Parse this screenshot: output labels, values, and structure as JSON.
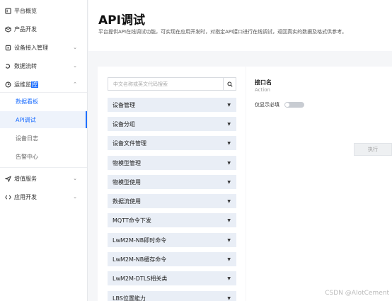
{
  "sidebar": {
    "items": [
      {
        "label": "平台概览",
        "icon": "home-icon",
        "chevron": ""
      },
      {
        "label": "产品开发",
        "icon": "box-icon",
        "chevron": ""
      },
      {
        "label": "设备接入管理",
        "icon": "device-icon",
        "chevron": "⌄"
      },
      {
        "label": "数据流转",
        "icon": "flow-icon",
        "chevron": "⌄"
      },
      {
        "label_pre": "运维监",
        "label_hl": "控",
        "icon": "monitor-icon",
        "chevron": "⌃"
      }
    ],
    "subitems": [
      {
        "label": "数据看板"
      },
      {
        "label": "API调试"
      },
      {
        "label": "设备日志"
      },
      {
        "label": "告警中心"
      }
    ],
    "bottom_items": [
      {
        "label": "增值服务",
        "icon": "send-icon",
        "chevron": "⌄"
      },
      {
        "label": "应用开发",
        "icon": "code-icon",
        "chevron": "⌄"
      }
    ]
  },
  "header": {
    "title": "API调试",
    "description": "平台提供API在线调试功能，可实现在应用开发时，对指定API接口进行在线调试，返回真实的数据及格式供参考。"
  },
  "search": {
    "placeholder": "中文名称或英文代码搜索"
  },
  "categories": [
    "设备管理",
    "设备分组",
    "设备文件管理",
    "物模型管理",
    "物模型使用",
    "数据流使用",
    "MQTT命令下发",
    "LwM2M-NB即时命令",
    "LwM2M-NB缓存命令",
    "LwM2M-DTLS相关类",
    "LBS位置能力"
  ],
  "detail": {
    "title": "接口名",
    "subtitle": "Action",
    "required_label": "仅显示必填",
    "execute_label": "执行"
  },
  "watermark": "CSDN @AIotCement",
  "colors": {
    "accent": "#1e6fff",
    "category_bg": "#e9eef6"
  }
}
